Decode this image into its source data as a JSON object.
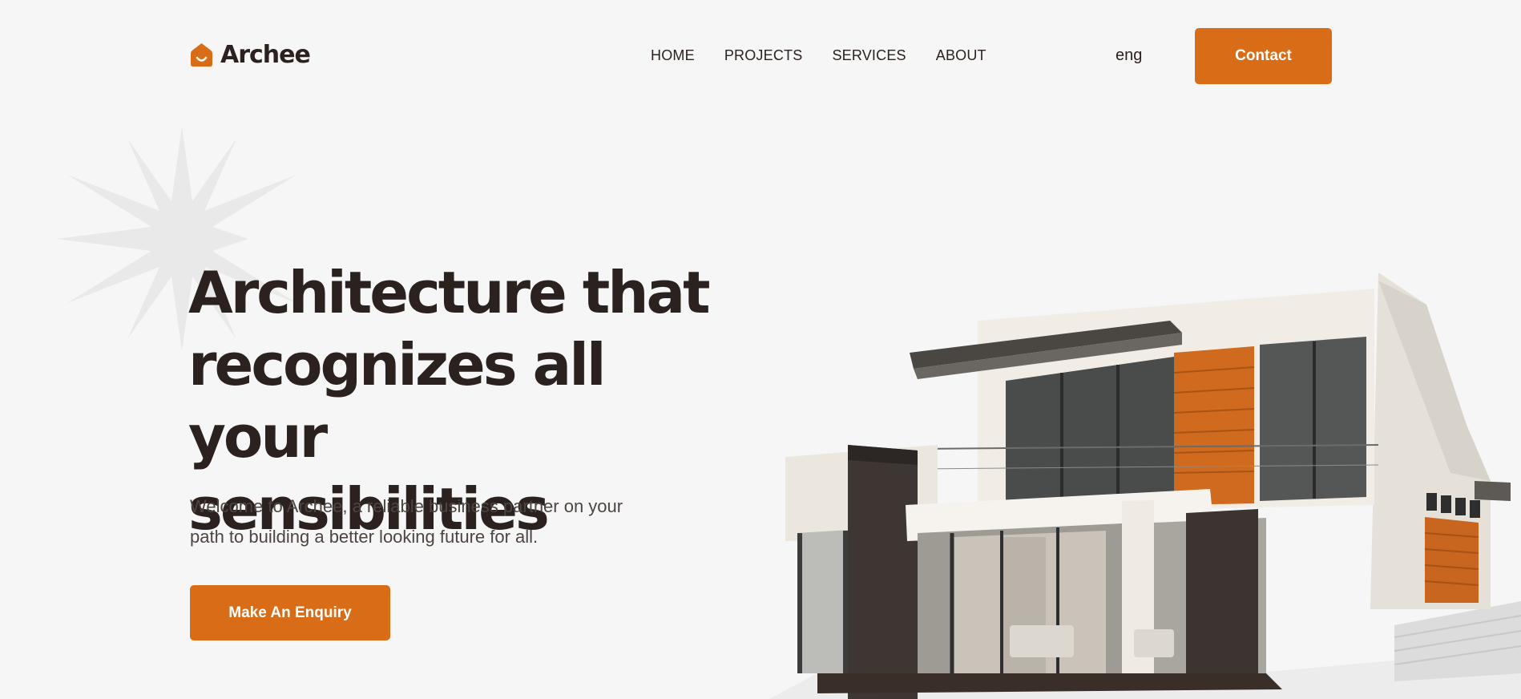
{
  "brand": {
    "name": "Archee",
    "accent_color": "#d96c16",
    "text_color": "#2b211e",
    "logo_icon": "house-smile-icon"
  },
  "nav": {
    "items": [
      {
        "label": "HOME"
      },
      {
        "label": "PROJECTS"
      },
      {
        "label": "SERVICES"
      },
      {
        "label": "ABOUT"
      }
    ]
  },
  "header": {
    "language": "eng",
    "contact_label": "Contact"
  },
  "hero": {
    "title_lines": [
      "Architecture that",
      "recognizes all your",
      "sensibilities"
    ],
    "subtitle_lines": [
      "Welcome to Archee, a reliable business partner on your",
      "path to building a better looking future for all."
    ],
    "cta_label": "Make An Enquiry",
    "decorations": [
      "starburst-icon",
      "house-illustration"
    ]
  }
}
